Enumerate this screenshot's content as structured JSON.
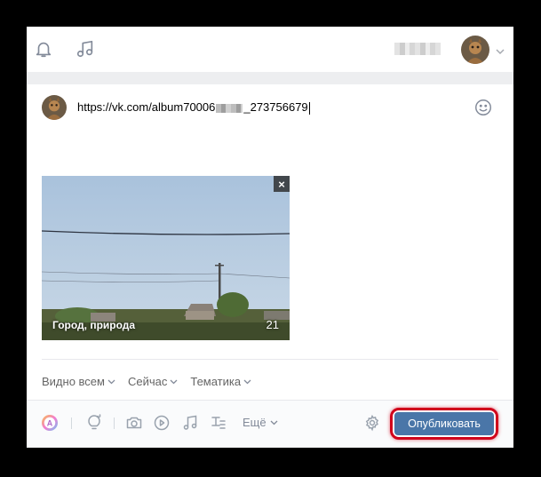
{
  "header": {
    "icons": [
      "bell-icon",
      "music-icon",
      "chevron-down-icon"
    ]
  },
  "post": {
    "text_start": "https://vk.com/album70006",
    "text_end": "_273756679",
    "icons": [
      "smile-icon"
    ]
  },
  "attachment": {
    "title": "Город, природа",
    "count": "21",
    "close_label": "×"
  },
  "options": {
    "visibility": "Видно всем",
    "time": "Сейчас",
    "topic": "Тематика"
  },
  "toolbar": {
    "icons": [
      "avatar-a-icon",
      "lightbulb-icon",
      "camera-icon",
      "video-icon",
      "music-icon",
      "poll-icon",
      "gear-icon"
    ],
    "more_label": "Ещё",
    "publish_label": "Опубликовать"
  },
  "colors": {
    "accent": "#4a76a8",
    "highlight": "#d0021b",
    "icon": "#99a2ad"
  }
}
